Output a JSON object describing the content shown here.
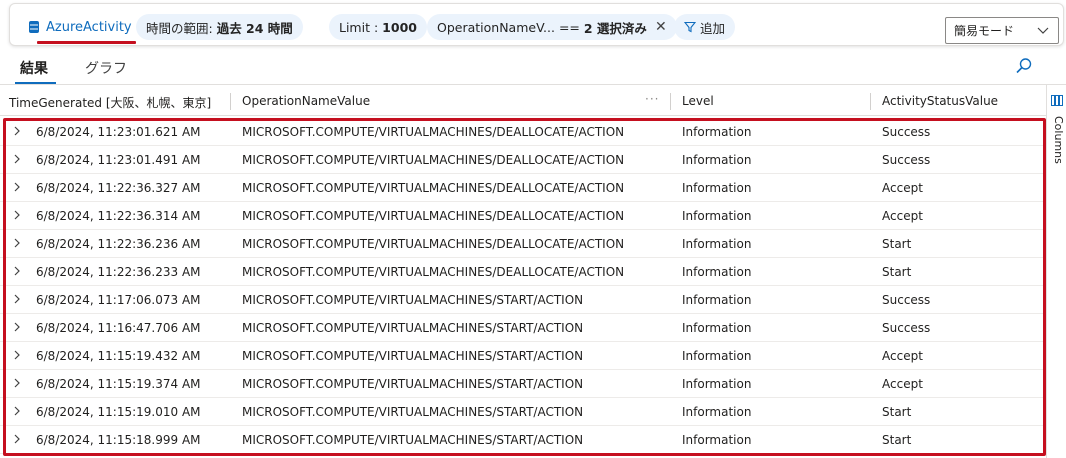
{
  "filter_bar": {
    "table_name": "AzureActivity",
    "time_range": {
      "label": "時間の範囲:",
      "value": "過去 24 時間"
    },
    "limit": {
      "label": "Limit :",
      "value": "1000"
    },
    "operation_filter": {
      "label": "OperationNameV...",
      "op": "==",
      "value": "2 選択済み"
    },
    "add_label": "追加",
    "mode": "簡易モード"
  },
  "tabs": [
    {
      "label": "結果",
      "active": true
    },
    {
      "label": "グラフ",
      "active": false
    }
  ],
  "side_panel": {
    "columns_label": "Columns"
  },
  "grid": {
    "columns": [
      "TimeGenerated [大阪、札幌、東京]",
      "OperationNameValue",
      "Level",
      "ActivityStatusValue"
    ],
    "rows": [
      [
        "6/8/2024, 11:23:01.621 AM",
        "MICROSOFT.COMPUTE/VIRTUALMACHINES/DEALLOCATE/ACTION",
        "Information",
        "Success"
      ],
      [
        "6/8/2024, 11:23:01.491 AM",
        "MICROSOFT.COMPUTE/VIRTUALMACHINES/DEALLOCATE/ACTION",
        "Information",
        "Success"
      ],
      [
        "6/8/2024, 11:22:36.327 AM",
        "MICROSOFT.COMPUTE/VIRTUALMACHINES/DEALLOCATE/ACTION",
        "Information",
        "Accept"
      ],
      [
        "6/8/2024, 11:22:36.314 AM",
        "MICROSOFT.COMPUTE/VIRTUALMACHINES/DEALLOCATE/ACTION",
        "Information",
        "Accept"
      ],
      [
        "6/8/2024, 11:22:36.236 AM",
        "MICROSOFT.COMPUTE/VIRTUALMACHINES/DEALLOCATE/ACTION",
        "Information",
        "Start"
      ],
      [
        "6/8/2024, 11:22:36.233 AM",
        "MICROSOFT.COMPUTE/VIRTUALMACHINES/DEALLOCATE/ACTION",
        "Information",
        "Start"
      ],
      [
        "6/8/2024, 11:17:06.073 AM",
        "MICROSOFT.COMPUTE/VIRTUALMACHINES/START/ACTION",
        "Information",
        "Success"
      ],
      [
        "6/8/2024, 11:16:47.706 AM",
        "MICROSOFT.COMPUTE/VIRTUALMACHINES/START/ACTION",
        "Information",
        "Success"
      ],
      [
        "6/8/2024, 11:15:19.432 AM",
        "MICROSOFT.COMPUTE/VIRTUALMACHINES/START/ACTION",
        "Information",
        "Accept"
      ],
      [
        "6/8/2024, 11:15:19.374 AM",
        "MICROSOFT.COMPUTE/VIRTUALMACHINES/START/ACTION",
        "Information",
        "Accept"
      ],
      [
        "6/8/2024, 11:15:19.010 AM",
        "MICROSOFT.COMPUTE/VIRTUALMACHINES/START/ACTION",
        "Information",
        "Start"
      ],
      [
        "6/8/2024, 11:15:18.999 AM",
        "MICROSOFT.COMPUTE/VIRTUALMACHINES/START/ACTION",
        "Information",
        "Start"
      ]
    ]
  },
  "colors": {
    "accent": "#0f6cbd",
    "highlight": "#c50f1f",
    "chip_bg": "#ebf3fc"
  }
}
